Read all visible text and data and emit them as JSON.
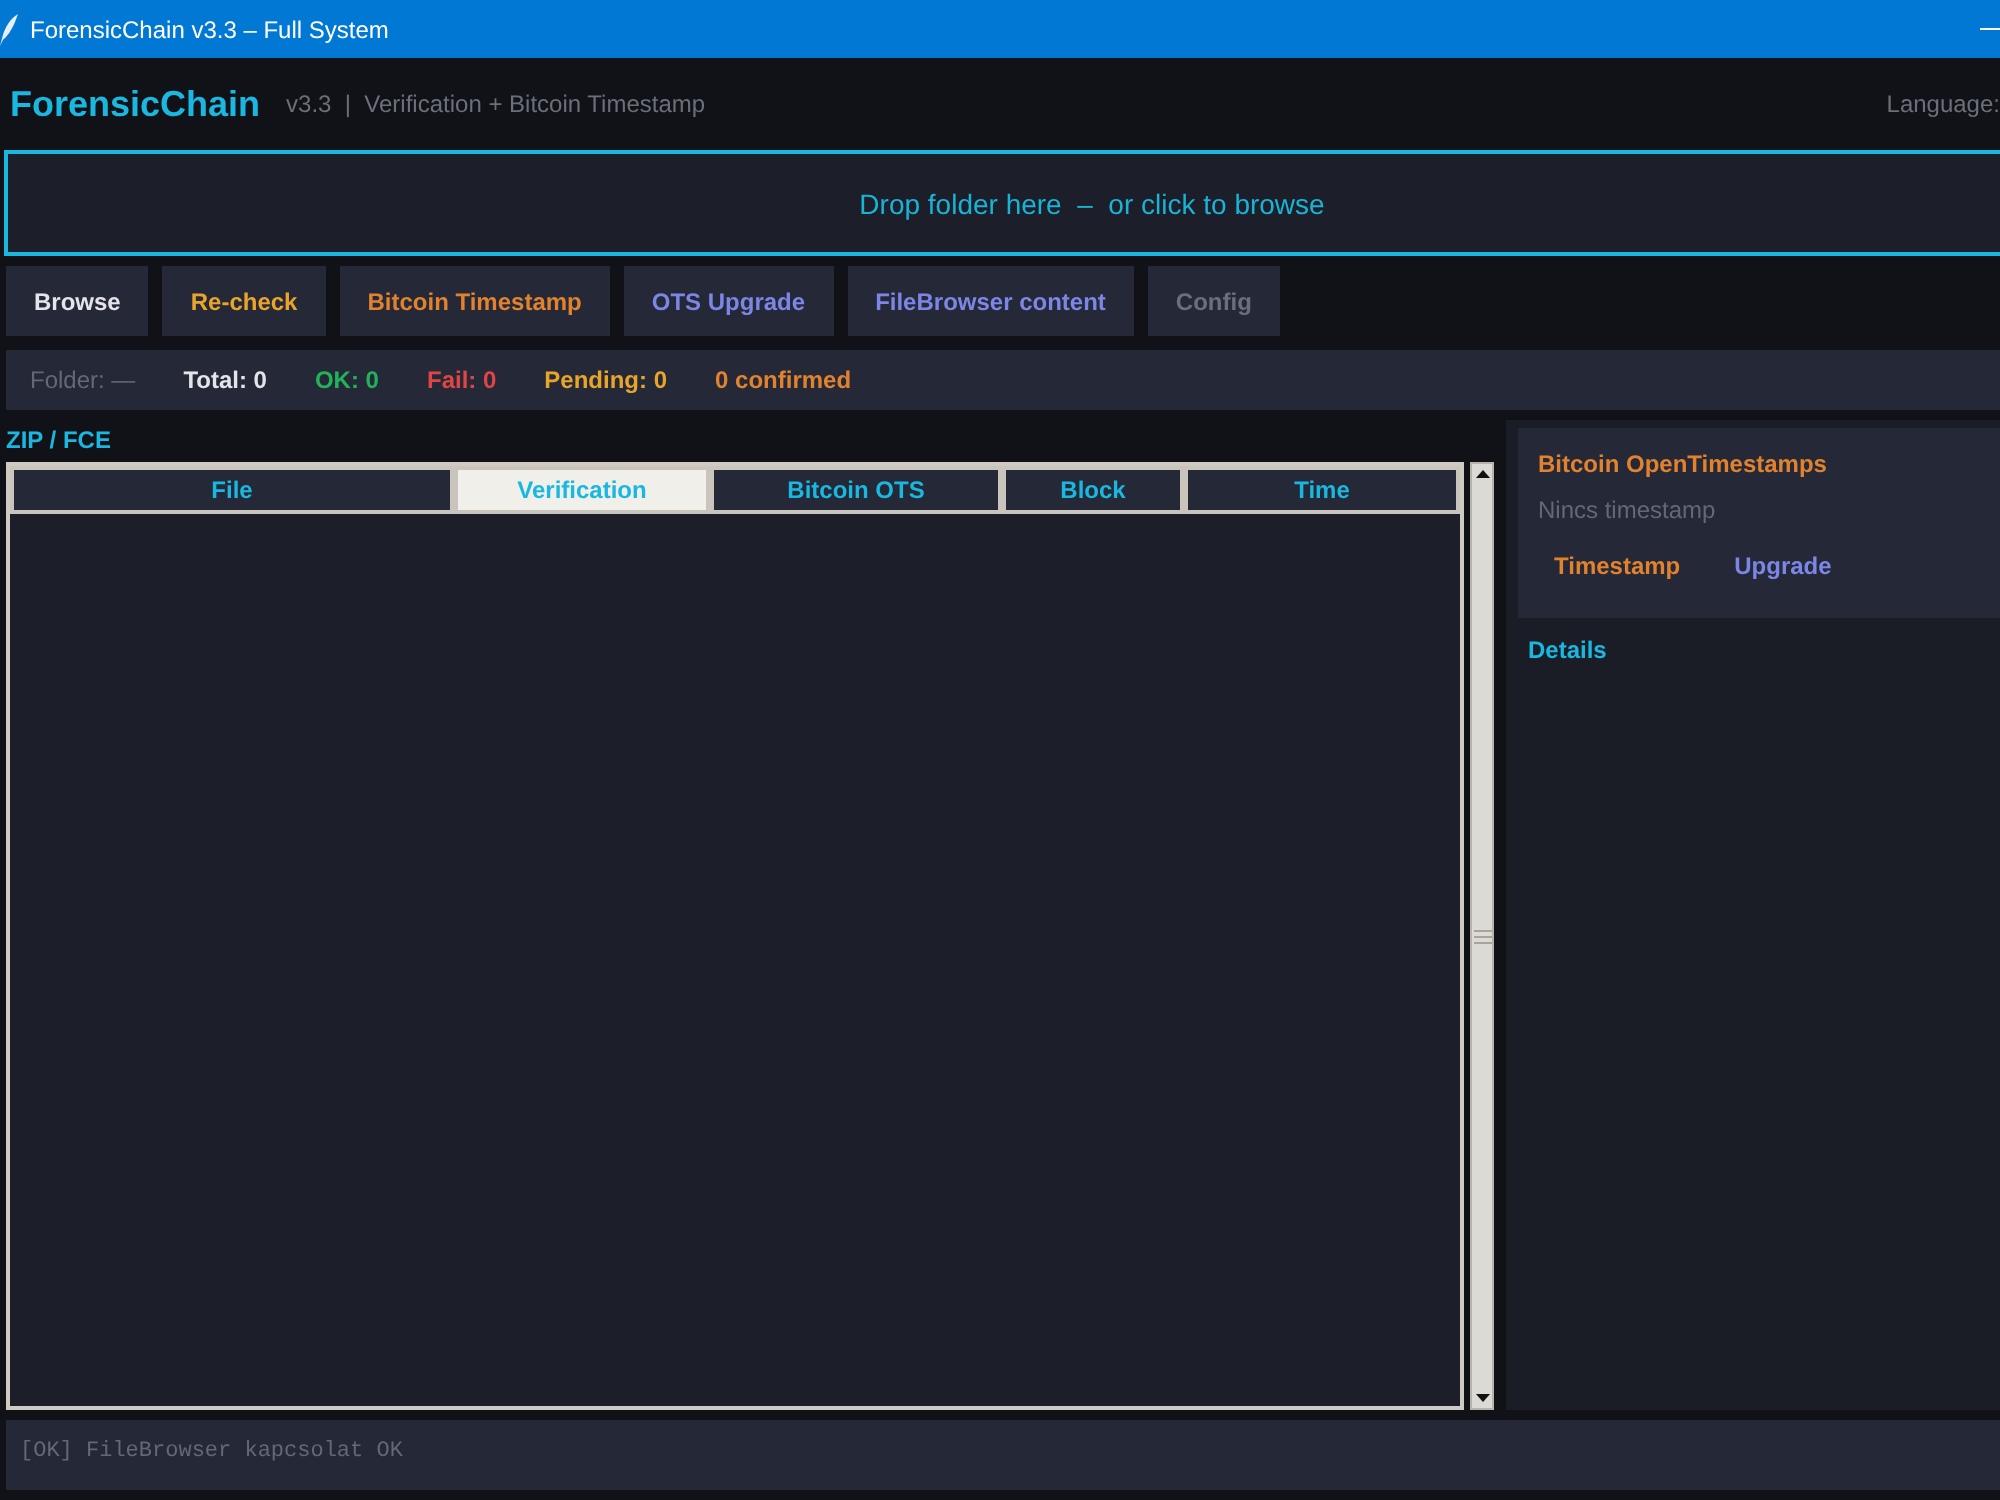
{
  "window": {
    "title": "ForensicChain v3.3 – Full System"
  },
  "header": {
    "app_name": "ForensicChain",
    "subtitle": "v3.3  |  Verification + Bitcoin Timestamp",
    "language_label": "Language:"
  },
  "drop_zone": {
    "text": "Drop folder here  –  or click to browse"
  },
  "toolbar": [
    {
      "label": "Browse",
      "color": "#e4e4ec"
    },
    {
      "label": "Re-check",
      "color": "#e8a52a"
    },
    {
      "label": "Bitcoin Timestamp",
      "color": "#e0822e"
    },
    {
      "label": "OTS Upgrade",
      "color": "#7c86e6"
    },
    {
      "label": "FileBrowser content",
      "color": "#7c86e6"
    },
    {
      "label": "Config",
      "color": "#6b6e7c"
    }
  ],
  "stats": [
    {
      "text": "Folder: —",
      "kind": "path",
      "color": "#646775"
    },
    {
      "text": "Total: 0",
      "kind": "count",
      "color": "#e4e4ec"
    },
    {
      "text": "OK: 0",
      "kind": "count",
      "color": "#22b35a"
    },
    {
      "text": "Fail: 0",
      "kind": "count",
      "color": "#e04545"
    },
    {
      "text": "Pending: 0",
      "kind": "count",
      "color": "#e8a52a"
    },
    {
      "text": "0 confirmed",
      "kind": "count",
      "color": "#e0822e"
    }
  ],
  "table": {
    "title": "ZIP / FCE",
    "columns": [
      {
        "label": "File",
        "selected": false
      },
      {
        "label": "Verification",
        "selected": true
      },
      {
        "label": "Bitcoin OTS",
        "selected": false
      },
      {
        "label": "Block",
        "selected": false
      },
      {
        "label": "Time",
        "selected": false
      }
    ]
  },
  "side_panel": {
    "card": {
      "title": "Bitcoin OpenTimestamps",
      "status": "Nincs timestamp",
      "buttons": [
        {
          "label": "Timestamp",
          "color": "#e0822e"
        },
        {
          "label": "Upgrade",
          "color": "#7c86e6"
        }
      ]
    },
    "details_title": "Details"
  },
  "log": {
    "lines": [
      "[OK] FileBrowser kapcsolat OK"
    ]
  }
}
